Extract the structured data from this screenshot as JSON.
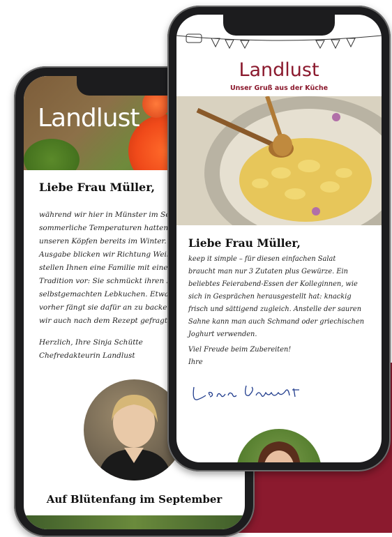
{
  "back_phone": {
    "logo": "Landlust",
    "greeting": "Liebe Frau Müller,",
    "body_lines": [
      "während wir hier in Münster im Sep",
      "sommerliche Temperaturen hatten, w",
      "unseren Köpfen bereits im Winter. In",
      "Ausgabe blicken wir Richtung Weihn",
      "stellen Ihnen eine Familie mit einer B",
      "Tradition vor: Sie schmückt ihren Ba",
      "selbstgemachten Lebkuchen. Etwa ei",
      "vorher fängt sie dafür an zu backen.",
      "wir auch nach dem Rezept gefragt..."
    ],
    "sign_lines": [
      "Herzlich, Ihre Sinja Schütte",
      "Chefredakteurin Landlust"
    ],
    "subheading": "Auf Blütenfang im September"
  },
  "front_phone": {
    "logo": "Landlust",
    "tagline": "Unser Gruß aus der Küche",
    "greeting": "Liebe Frau Müller,",
    "body_lines": [
      "keep it simple – für diesen einfachen Salat",
      "braucht man nur 3 Zutaten plus Gewürze. Ein",
      "beliebtes Feierabend-Essen der Kolleginnen, wie",
      "sich in Gesprächen herausgestellt hat: knackig",
      "frisch und sättigend zugleich. Anstelle der sauren",
      "Sahne kann man auch Schmand oder griechischen",
      "Joghurt verwenden."
    ],
    "sign_lines": [
      "Viel Freude beim Zubereiten!",
      "Ihre"
    ],
    "signature": "Lena Pfannschmidt"
  }
}
